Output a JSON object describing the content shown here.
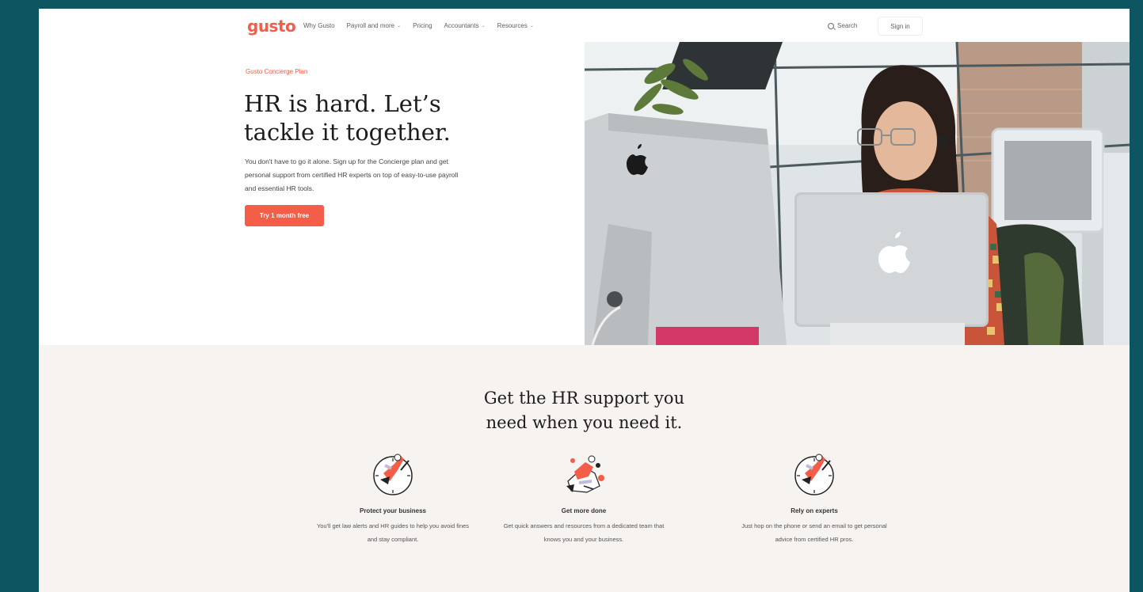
{
  "nav": {
    "logo": "gusto",
    "links": [
      {
        "label": "Why Gusto",
        "dropdown": false
      },
      {
        "label": "Payroll and more",
        "dropdown": true
      },
      {
        "label": "Pricing",
        "dropdown": false
      },
      {
        "label": "Accountants",
        "dropdown": true
      },
      {
        "label": "Resources",
        "dropdown": true
      }
    ],
    "search_label": "Search",
    "signin_label": "Sign in"
  },
  "hero": {
    "eyebrow": "Gusto Concierge Plan",
    "headline": "HR is hard. Let’s tackle it together.",
    "subtext": "You don't have to go it alone. Sign up for the Concierge plan and get personal support from certified HR experts on top of easy-to-use payroll and essential HR tools.",
    "cta_label": "Try 1 month free"
  },
  "support": {
    "title": "Get the HR support you need when you need it.",
    "features": [
      {
        "icon": "clock-figure-icon",
        "title": "Protect your business",
        "desc": "You'll get law alerts and HR guides to help you avoid fines and stay compliant."
      },
      {
        "icon": "juggling-figure-icon",
        "title": "Get more done",
        "desc": "Get quick answers and resources from a dedicated team that knows you and your business."
      },
      {
        "icon": "clock-figure-icon",
        "title": "Rely on experts",
        "desc": "Just hop on the phone or send an email to get personal advice from certified HR pros."
      }
    ]
  },
  "colors": {
    "brand": "#f45d48",
    "frame_bg": "#0d5560",
    "section_bg": "#f7f3f0"
  }
}
